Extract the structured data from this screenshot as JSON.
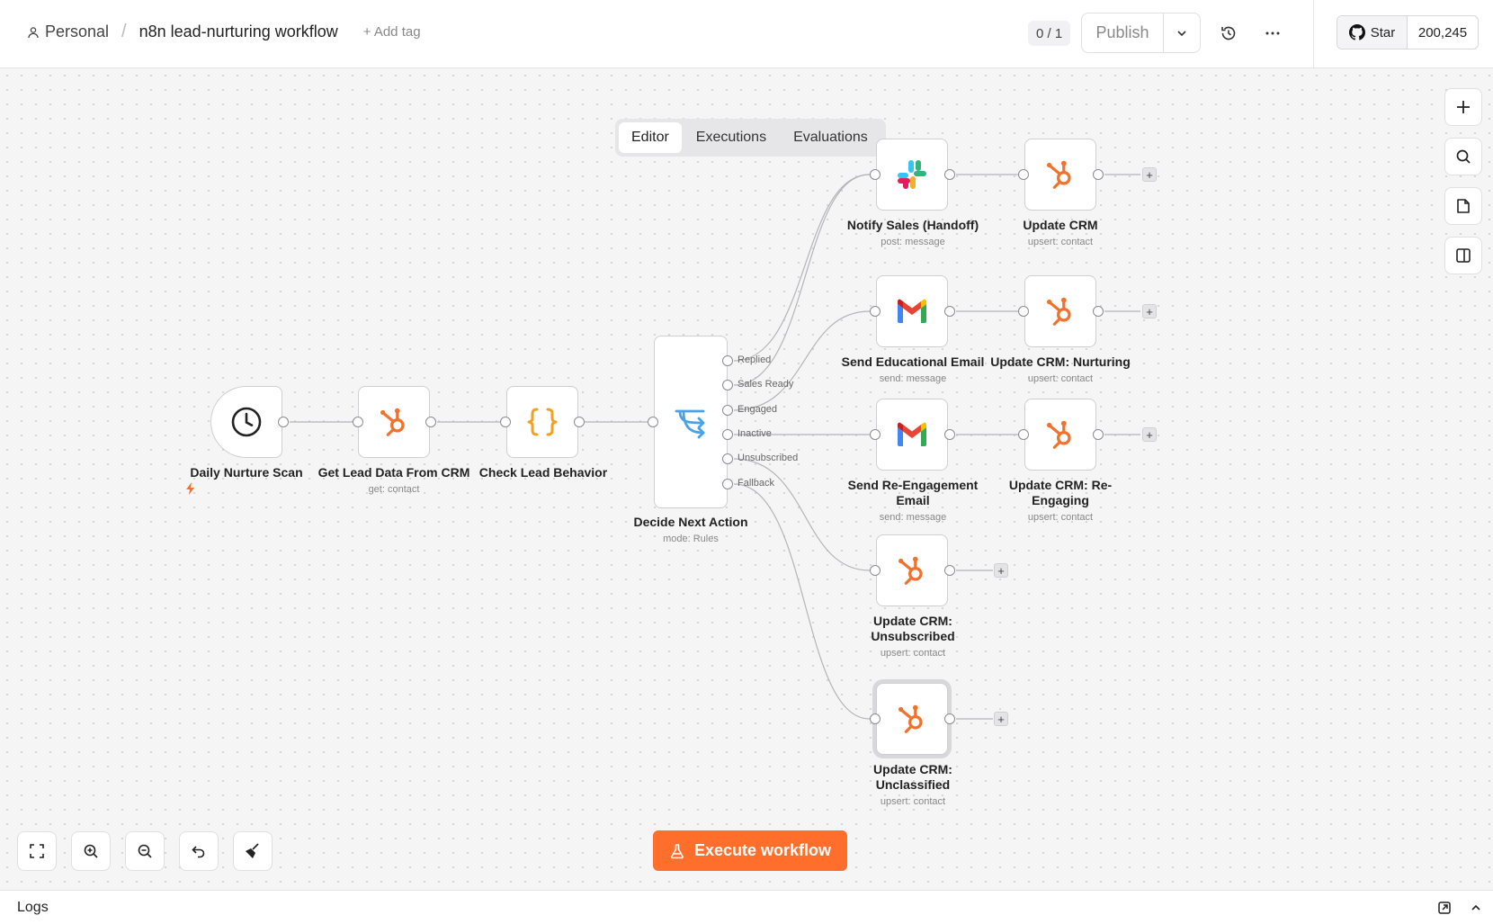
{
  "header": {
    "owner": "Personal",
    "workflow_name": "n8n lead-nurturing workflow",
    "add_tag": "+ Add tag",
    "version": "0 / 1",
    "publish": "Publish",
    "github_star": "Star",
    "github_count": "200,245"
  },
  "tabs": [
    {
      "label": "Editor",
      "active": true
    },
    {
      "label": "Executions",
      "active": false
    },
    {
      "label": "Evaluations",
      "active": false
    }
  ],
  "nodes": {
    "trigger": {
      "name": "Daily Nurture Scan",
      "icon": "clock-icon"
    },
    "get_lead": {
      "name": "Get Lead Data From CRM",
      "subtitle": "get: contact",
      "icon": "hubspot-icon"
    },
    "check_behavior": {
      "name": "Check Lead Behavior",
      "icon": "code-braces-icon"
    },
    "decide": {
      "name": "Decide Next Action",
      "subtitle": "mode: Rules",
      "icon": "switch-icon",
      "outputs": [
        "Replied",
        "Sales Ready",
        "Engaged",
        "Inactive",
        "Unsubscribed",
        "Fallback"
      ]
    },
    "notify_sales": {
      "name": "Notify Sales (Handoff)",
      "subtitle": "post: message",
      "icon": "slack-icon"
    },
    "update_crm": {
      "name": "Update CRM",
      "subtitle": "upsert: contact",
      "icon": "hubspot-icon"
    },
    "send_edu": {
      "name": "Send Educational Email",
      "subtitle": "send: message",
      "icon": "gmail-icon"
    },
    "update_nurturing": {
      "name": "Update CRM: Nurturing",
      "subtitle": "upsert: contact",
      "icon": "hubspot-icon"
    },
    "send_reengage": {
      "name": "Send Re-Engagement Email",
      "subtitle": "send: message",
      "icon": "gmail-icon"
    },
    "update_reengaging": {
      "name": "Update CRM: Re-Engaging",
      "subtitle": "upsert: contact",
      "icon": "hubspot-icon"
    },
    "update_unsub": {
      "name": "Update CRM: Unsubscribed",
      "subtitle": "upsert: contact",
      "icon": "hubspot-icon"
    },
    "update_unclass": {
      "name": "Update CRM: Unclassified",
      "subtitle": "upsert: contact",
      "icon": "hubspot-icon"
    }
  },
  "execute_button": "Execute workflow",
  "logs": {
    "title": "Logs"
  },
  "colors": {
    "accent": "#ff6f2b",
    "hubspot": "#f0722c",
    "code": "#f5a020",
    "switch": "#4aa3e8",
    "canvas": "#f5f5f5"
  }
}
